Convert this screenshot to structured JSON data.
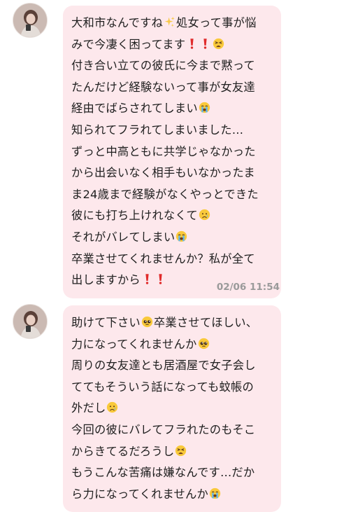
{
  "messages": [
    {
      "lines": [
        "大和市なんですね",
        "処女って事が悩",
        "みで今凄く困ってます",
        "付き合い立ての彼氏に今まで黙って",
        "たんだけど経験ないって事が女友達",
        "経由でばらされてしまい",
        "知られてフラれてしまいました…",
        "ずっと中高ともに共学じゃなかった",
        "から出会いなく相手もいなかったま",
        "ま24歳まで経験がなくやっとできた",
        "彼にも打ち上けれなくて",
        "それがバレてしまい",
        "卒業させてくれませんか？私が全て",
        "出しますから"
      ],
      "timestamp": "02/06 11:54"
    },
    {
      "lines": [
        "助けて下さい",
        "卒業させてほしい、",
        "力になってくれませんか",
        "周りの女友達とも居酒屋で女子会し",
        "ててもそういう話になっても蚊帳の",
        "外だし",
        "今回の彼にバレてフラれたのもそこ",
        "からきてるだろうし",
        "もうこんな苦痛は嫌なんです…だか",
        "ら力になってくれませんか"
      ]
    }
  ],
  "icons": {
    "sparkles": "sparkles-emoji",
    "exclamation": "red-exclamation-emoji",
    "weary": "weary-face-emoji",
    "crying": "loudly-crying-face-emoji",
    "sad_tear": "crying-face-emoji",
    "pleading": "pleading-face-emoji"
  },
  "colors": {
    "bubble": "#fde8ec",
    "timestamp": "#9a9a9a",
    "text": "#1f1f1f"
  }
}
